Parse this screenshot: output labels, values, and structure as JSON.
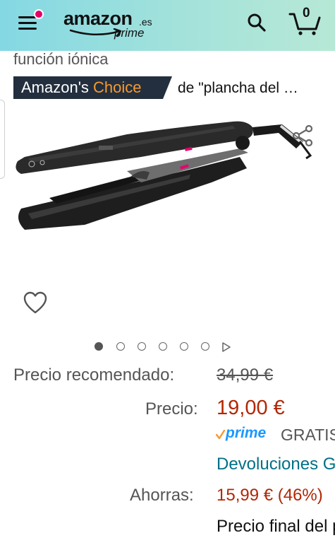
{
  "header": {
    "logo_text": "amazon",
    "logo_domain": ".es",
    "logo_prime": "prime",
    "cart_count": "0",
    "icons": [
      "menu-icon",
      "search-icon",
      "cart-icon"
    ],
    "menu_notification_color": "#e3006a"
  },
  "product": {
    "title_snippet": "función iónica",
    "badge": {
      "prefix": "Amazon's",
      "accent": "Choice",
      "accent_color": "#f69931",
      "query": "de \"plancha del …"
    },
    "image_alt": "plancha de pelo"
  },
  "carousel": {
    "total_dots": 6,
    "active_index": 0
  },
  "pricing": {
    "rrp_label": "Precio recomendado:",
    "rrp_value": "34,99 €",
    "price_label": "Precio:",
    "price_value": "19,00 €",
    "prime_label": "prime",
    "prime_extra": "GRATIS",
    "returns_link": "Devoluciones GRATIS",
    "savings_label": "Ahorras:",
    "savings_value": "15,99 € (46%)",
    "final_price": "Precio final del producto",
    "price_color": "#b12704",
    "link_color": "#007185",
    "prime_color": "#1a98ff"
  }
}
